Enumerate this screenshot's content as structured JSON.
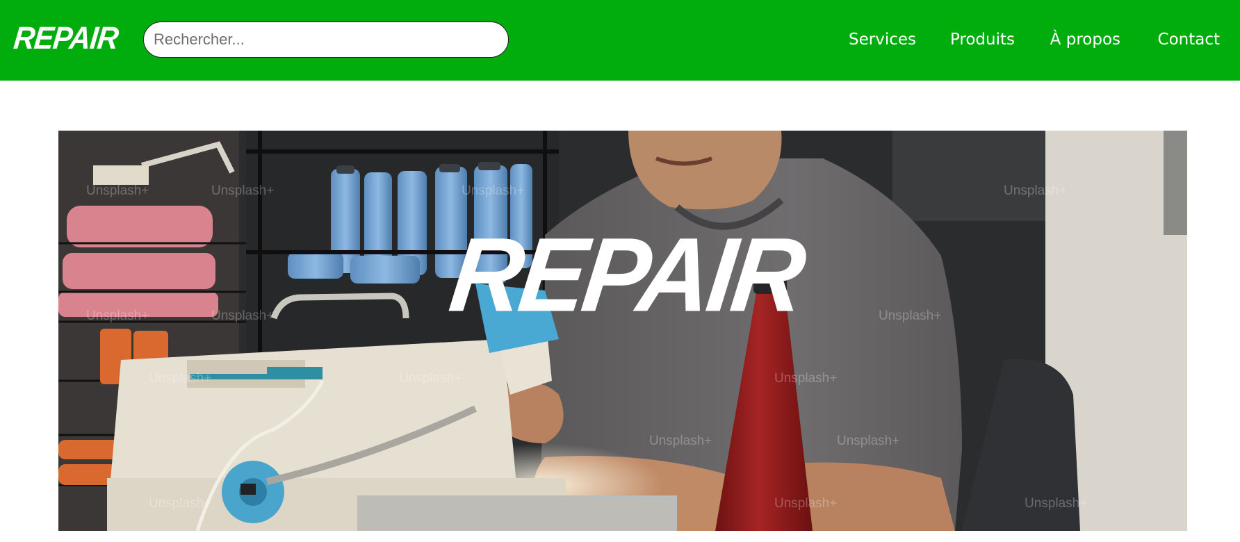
{
  "header": {
    "logo": "REPAIR",
    "search_placeholder": "Rechercher...",
    "nav": [
      "Services",
      "Produits",
      "À propos",
      "Contact"
    ]
  },
  "hero": {
    "title": "REPAIR",
    "watermark": "Unsplash+"
  },
  "colors": {
    "brand_green": "#00ad0c",
    "text_on_brand": "#ffffff"
  }
}
